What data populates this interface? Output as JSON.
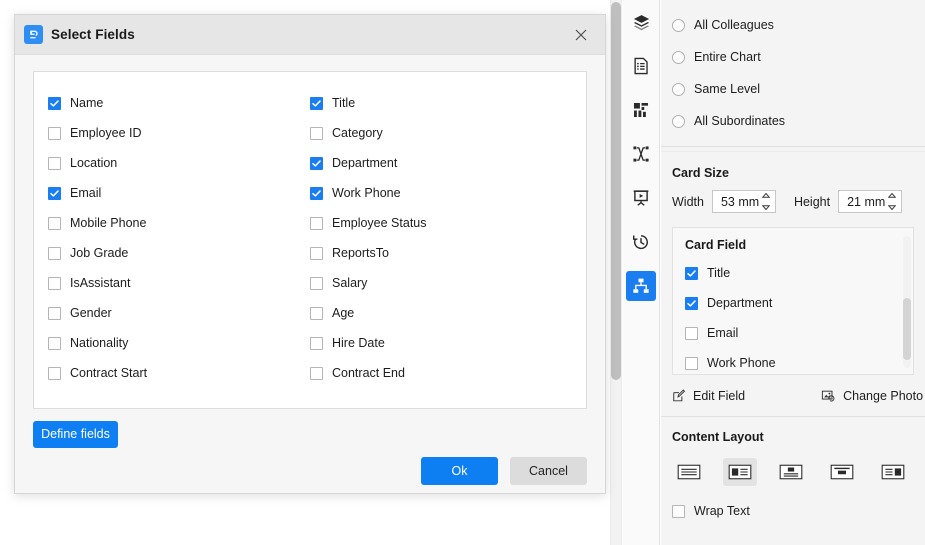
{
  "dialog": {
    "title": "Select Fields",
    "icon": "app-logo-icon",
    "close_icon": "close-icon",
    "fields_left": [
      {
        "label": "Name",
        "checked": true
      },
      {
        "label": "Employee ID",
        "checked": false
      },
      {
        "label": "Location",
        "checked": false
      },
      {
        "label": "Email",
        "checked": true
      },
      {
        "label": "Mobile Phone",
        "checked": false
      },
      {
        "label": "Job Grade",
        "checked": false
      },
      {
        "label": "IsAssistant",
        "checked": false
      },
      {
        "label": "Gender",
        "checked": false
      },
      {
        "label": "Nationality",
        "checked": false
      },
      {
        "label": "Contract Start",
        "checked": false
      }
    ],
    "fields_right": [
      {
        "label": "Title",
        "checked": true
      },
      {
        "label": "Category",
        "checked": false
      },
      {
        "label": "Department",
        "checked": true
      },
      {
        "label": "Work Phone",
        "checked": true
      },
      {
        "label": "Employee Status",
        "checked": false
      },
      {
        "label": "ReportsTo",
        "checked": false
      },
      {
        "label": "Salary",
        "checked": false
      },
      {
        "label": "Age",
        "checked": false
      },
      {
        "label": "Hire Date",
        "checked": false
      },
      {
        "label": "Contract End",
        "checked": false
      }
    ],
    "define_fields_label": "Define fields",
    "ok_label": "Ok",
    "cancel_label": "Cancel"
  },
  "icon_rail": {
    "items": [
      {
        "name": "layers-icon",
        "active": false
      },
      {
        "name": "document-list-icon",
        "active": false
      },
      {
        "name": "dashboard-icon",
        "active": false
      },
      {
        "name": "connector-icon",
        "active": false
      },
      {
        "name": "presentation-icon",
        "active": false
      },
      {
        "name": "history-icon",
        "active": false
      },
      {
        "name": "org-chart-icon",
        "active": true
      }
    ]
  },
  "right_panel": {
    "selection_options": [
      {
        "label": "All Colleagues",
        "selected": false
      },
      {
        "label": "Entire Chart",
        "selected": false
      },
      {
        "label": "Same Level",
        "selected": false
      },
      {
        "label": "All Subordinates",
        "selected": false
      }
    ],
    "card_size": {
      "title": "Card Size",
      "width_label": "Width",
      "width_value": "53 mm",
      "height_label": "Height",
      "height_value": "21 mm"
    },
    "card_field": {
      "title": "Card Field",
      "items": [
        {
          "label": "Title",
          "checked": true
        },
        {
          "label": "Department",
          "checked": true
        },
        {
          "label": "Email",
          "checked": false
        },
        {
          "label": "Work Phone",
          "checked": false
        }
      ]
    },
    "actions": {
      "edit_field_label": "Edit Field",
      "edit_field_icon": "edit-square-icon",
      "change_photo_label": "Change Photo",
      "change_photo_icon": "change-photo-icon"
    },
    "content_layout": {
      "title": "Content Layout",
      "options": [
        {
          "name": "layout-text-only-icon",
          "selected": false
        },
        {
          "name": "layout-photo-left-icon",
          "selected": true
        },
        {
          "name": "layout-photo-top-icon",
          "selected": false
        },
        {
          "name": "layout-photo-banner-icon",
          "selected": false
        },
        {
          "name": "layout-photo-right-icon",
          "selected": false
        }
      ],
      "wrap_text_label": "Wrap Text",
      "wrap_text_checked": false
    }
  },
  "colors": {
    "accent": "#1a7ef0",
    "primary_button": "#0d7ff2",
    "secondary_button": "#dcdcdc",
    "panel_bg": "#f4f4f4",
    "dialog_bg": "#f6f6f6"
  }
}
